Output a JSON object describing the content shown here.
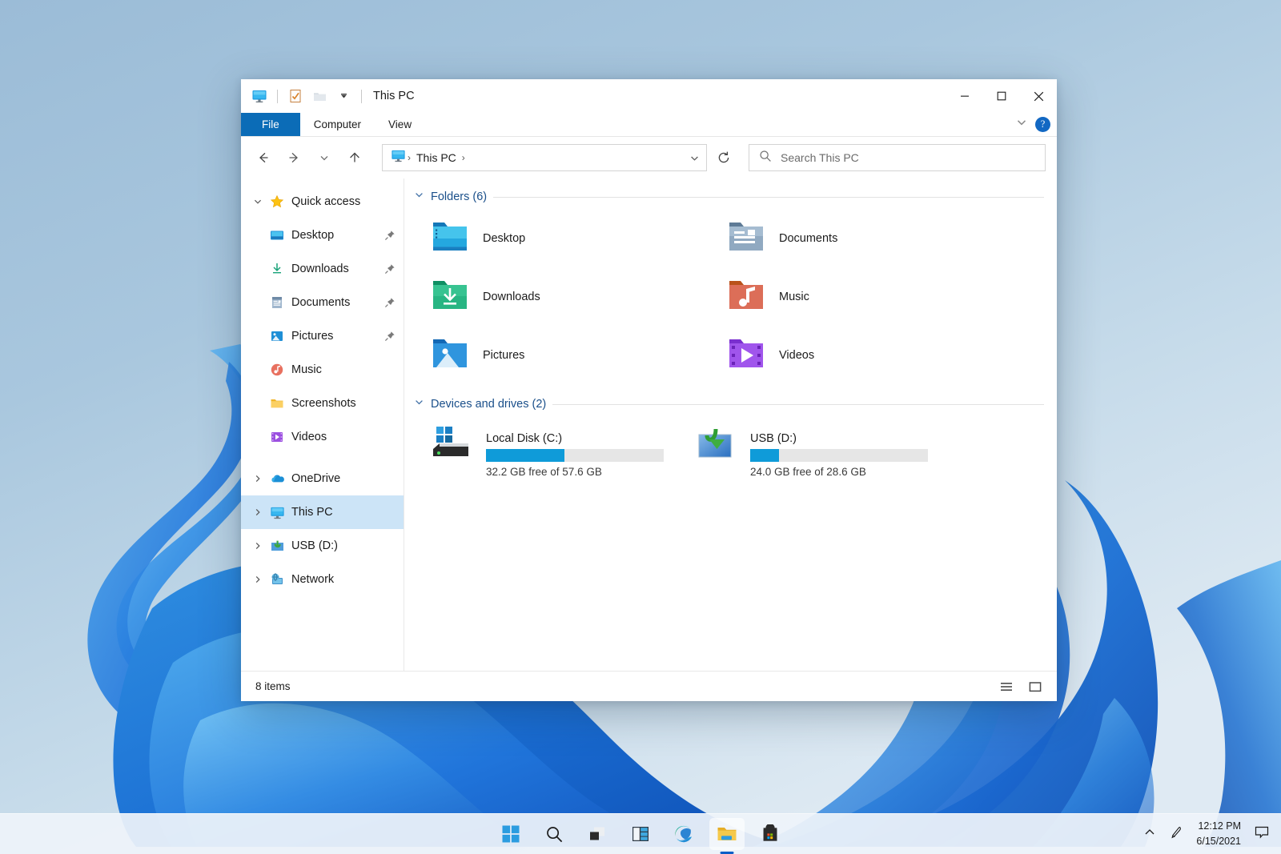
{
  "window": {
    "title": "This PC",
    "quick_access_toolbar": [
      {
        "name": "this-pc-icon",
        "label": "This PC"
      },
      {
        "name": "properties-icon",
        "label": "Properties"
      },
      {
        "name": "new-folder-icon",
        "label": "New folder"
      },
      {
        "name": "customize-qat-chevron-icon",
        "label": "Customize Quick Access Toolbar"
      }
    ],
    "controls": {
      "minimize": "─",
      "maximize": "☐",
      "close": "✕"
    }
  },
  "ribbon": {
    "tabs": [
      {
        "label": "File",
        "active": true
      },
      {
        "label": "Computer",
        "active": false
      },
      {
        "label": "View",
        "active": false
      }
    ],
    "expand_label": "⌄",
    "help_label": "?"
  },
  "navbar": {
    "back_label": "←",
    "forward_label": "→",
    "recent_label": "⌄",
    "up_label": "↑",
    "breadcrumb": [
      "This PC"
    ],
    "breadcrumb_separator": "›",
    "address_dropdown_label": "⌄",
    "refresh_label": "↻",
    "search_placeholder": "Search This PC",
    "search_value": ""
  },
  "sidebar": {
    "items": [
      {
        "label": "Quick access",
        "icon": "star-icon",
        "chevron": "down",
        "indent": 0,
        "pinned": false,
        "selected": false
      },
      {
        "label": "Desktop",
        "icon": "desktop-folder-icon",
        "chevron": "none",
        "indent": 1,
        "pinned": true,
        "selected": false
      },
      {
        "label": "Downloads",
        "icon": "downloads-arrow-icon",
        "chevron": "none",
        "indent": 1,
        "pinned": true,
        "selected": false
      },
      {
        "label": "Documents",
        "icon": "documents-icon",
        "chevron": "none",
        "indent": 1,
        "pinned": true,
        "selected": false
      },
      {
        "label": "Pictures",
        "icon": "pictures-icon",
        "chevron": "none",
        "indent": 1,
        "pinned": true,
        "selected": false
      },
      {
        "label": "Music",
        "icon": "music-icon",
        "chevron": "none",
        "indent": 1,
        "pinned": false,
        "selected": false
      },
      {
        "label": "Screenshots",
        "icon": "folder-icon",
        "chevron": "none",
        "indent": 1,
        "pinned": false,
        "selected": false
      },
      {
        "label": "Videos",
        "icon": "videos-icon",
        "chevron": "none",
        "indent": 1,
        "pinned": false,
        "selected": false
      },
      {
        "label": "OneDrive",
        "icon": "onedrive-cloud-icon",
        "chevron": "right",
        "indent": 0,
        "pinned": false,
        "selected": false
      },
      {
        "label": "This PC",
        "icon": "this-pc-icon",
        "chevron": "right",
        "indent": 0,
        "pinned": false,
        "selected": true
      },
      {
        "label": "USB (D:)",
        "icon": "usb-drive-icon",
        "chevron": "right",
        "indent": 0,
        "pinned": false,
        "selected": false
      },
      {
        "label": "Network",
        "icon": "network-icon",
        "chevron": "right",
        "indent": 0,
        "pinned": false,
        "selected": false
      }
    ]
  },
  "main": {
    "folders_group": {
      "title": "Folders (6)",
      "collapse_chevron": "⌄",
      "items": [
        {
          "label": "Desktop",
          "icon": "desktop-folder-icon"
        },
        {
          "label": "Documents",
          "icon": "documents-folder-icon"
        },
        {
          "label": "Downloads",
          "icon": "downloads-folder-icon"
        },
        {
          "label": "Music",
          "icon": "music-folder-icon"
        },
        {
          "label": "Pictures",
          "icon": "pictures-folder-icon"
        },
        {
          "label": "Videos",
          "icon": "videos-folder-icon"
        }
      ]
    },
    "drives_group": {
      "title": "Devices and drives (2)",
      "collapse_chevron": "⌄",
      "items": [
        {
          "name": "Local Disk (C:)",
          "icon": "hard-drive-icon",
          "free_text": "32.2 GB free of 57.6 GB",
          "used_percent": 44
        },
        {
          "name": "USB (D:)",
          "icon": "usb-drive-icon",
          "free_text": "24.0 GB free of 28.6 GB",
          "used_percent": 16
        }
      ]
    }
  },
  "statusbar": {
    "item_count": "8 items",
    "views": [
      {
        "name": "details-view-button",
        "label": "☰"
      },
      {
        "name": "large-icons-view-button",
        "label": "▢"
      }
    ]
  },
  "taskbar": {
    "items": [
      {
        "name": "start-button",
        "label": "Start",
        "active": false
      },
      {
        "name": "search-button",
        "label": "Search",
        "active": false
      },
      {
        "name": "task-view-button",
        "label": "Task View",
        "active": false
      },
      {
        "name": "widgets-button",
        "label": "Widgets",
        "active": false
      },
      {
        "name": "edge-button",
        "label": "Microsoft Edge",
        "active": false
      },
      {
        "name": "file-explorer-button",
        "label": "File Explorer",
        "active": true
      },
      {
        "name": "microsoft-store-button",
        "label": "Microsoft Store",
        "active": false
      }
    ],
    "tray": {
      "show_hidden_label": "⌃",
      "pen_label": "pen-icon",
      "time": "12:12 PM",
      "date": "6/15/2021",
      "notification_label": "notification-icon"
    }
  },
  "colors": {
    "accent": "#0b6cb7",
    "selection": "#cce4f7",
    "group_title": "#1a4f8a",
    "drive_bar": "#0f9bd9",
    "taskbar_indicator": "#0a5ec7"
  }
}
